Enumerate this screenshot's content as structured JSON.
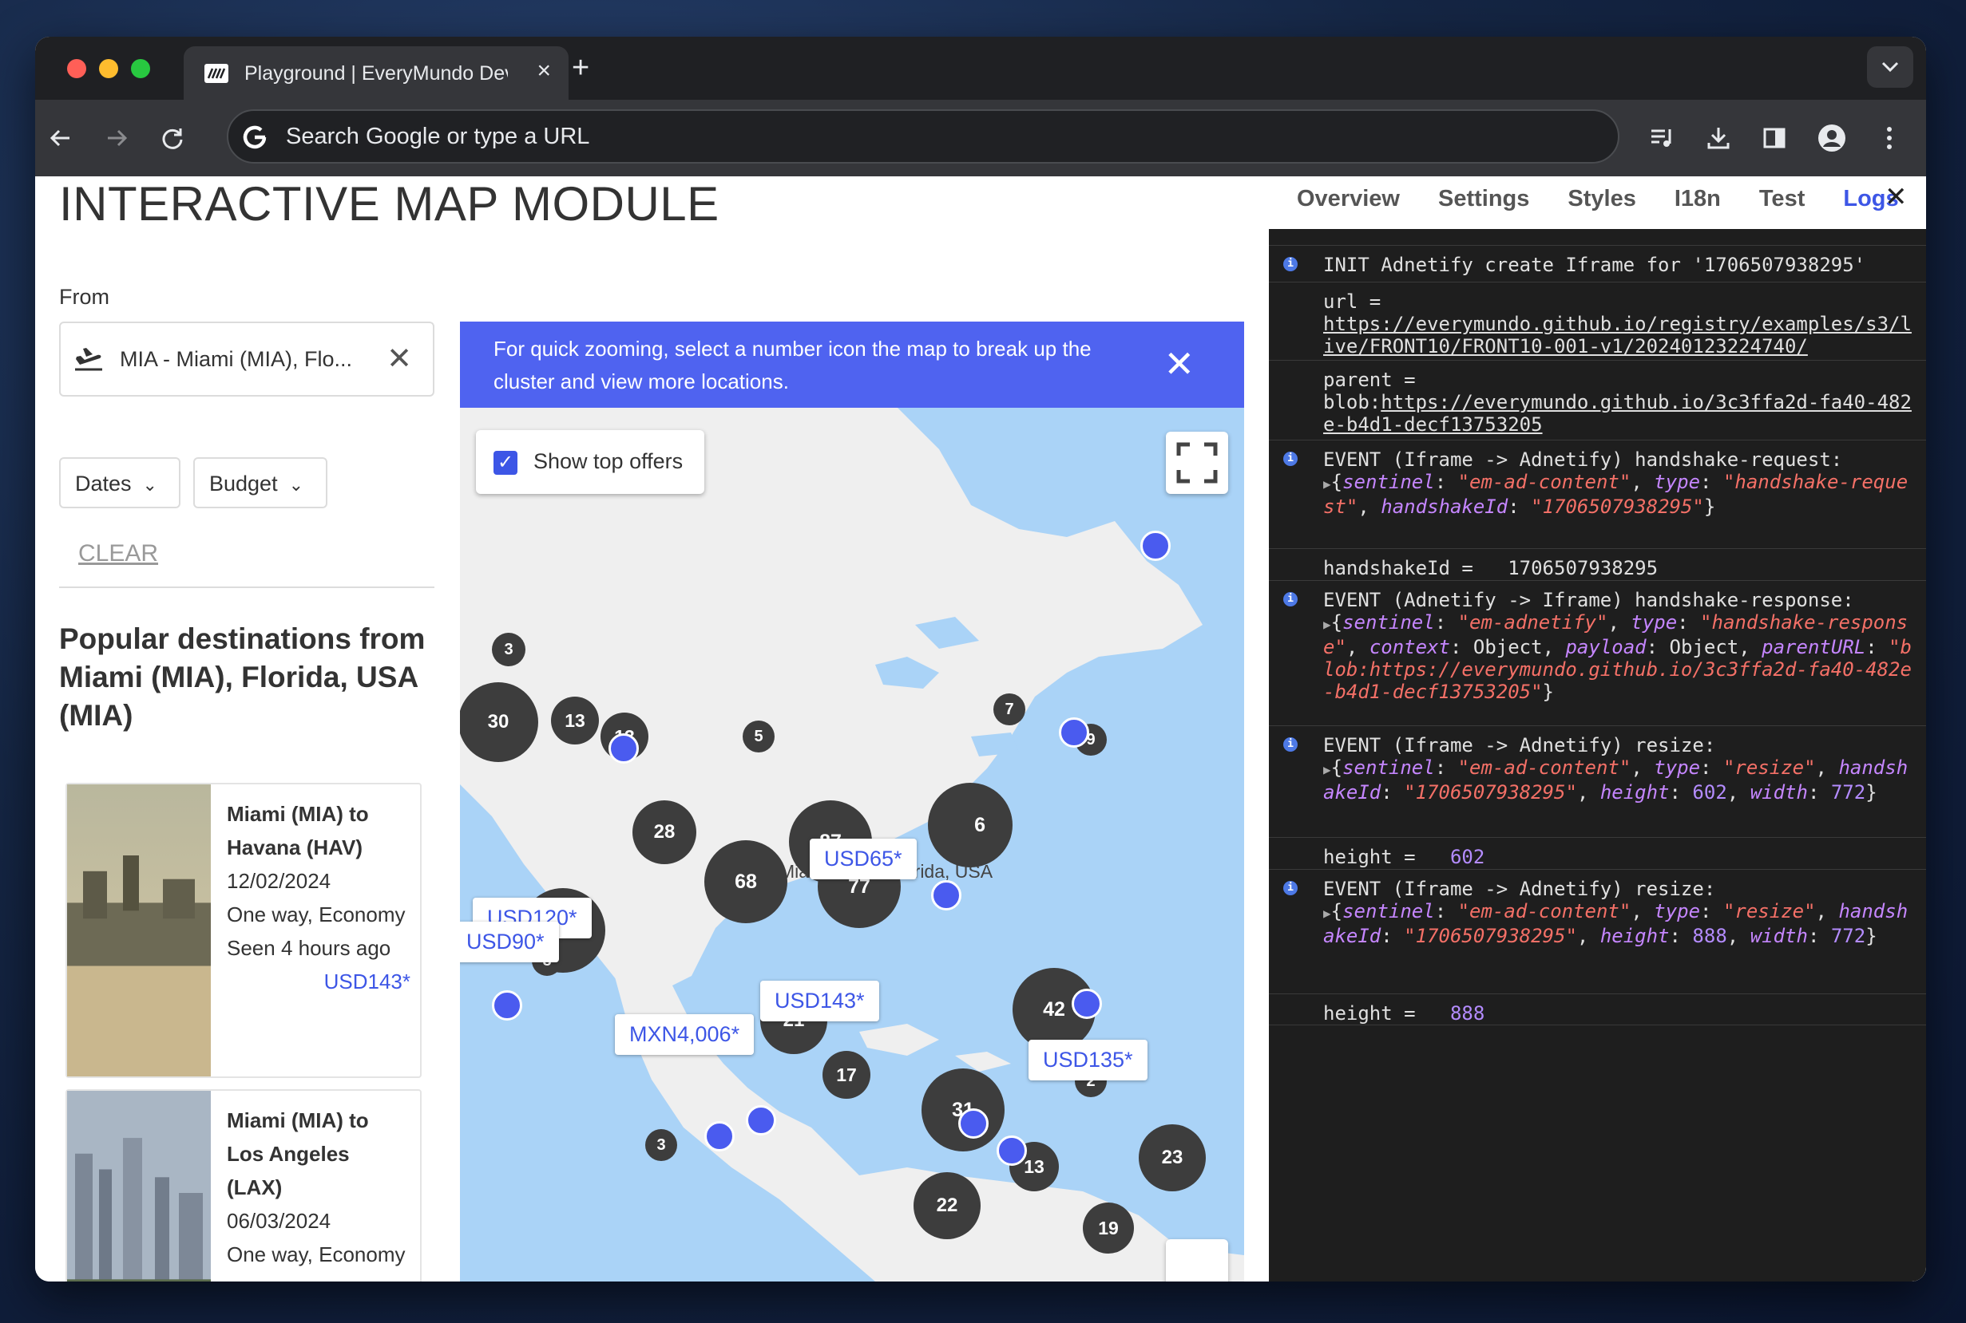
{
  "browser": {
    "tab_title": "Playground | EveryMundo Dev",
    "omnibox_placeholder": "Search Google or type a URL"
  },
  "page": {
    "title": "INTERACTIVE MAP MODULE",
    "tabs": [
      "Overview",
      "Settings",
      "Styles",
      "I18n",
      "Test",
      "Logs"
    ],
    "active_tab": "Logs"
  },
  "search": {
    "from_label": "From",
    "from_value": "MIA - Miami (MIA), Flo...",
    "dates_label": "Dates",
    "budget_label": "Budget",
    "clear_label": "CLEAR"
  },
  "popular": {
    "title": "Popular destinations from Miami (MIA), Florida, USA (MIA)",
    "cards": [
      {
        "route": "Miami (MIA) to Havana (HAV)",
        "date": "12/02/2024",
        "fare": "One way, Economy",
        "seen": "Seen 4 hours ago",
        "price": "USD143*"
      },
      {
        "route": "Miami (MIA) to Los Angeles (LAX)",
        "date": "06/03/2024",
        "fare": "One way, Economy",
        "seen": "",
        "price": ""
      }
    ]
  },
  "map": {
    "banner": "For quick zooming, select a number icon the map to break up the cluster and view more locations.",
    "show_top_offers": "Show top offers",
    "show_top_offers_checked": true,
    "city_label": "Miami (MIA), Florida, USA",
    "clusters": [
      "3",
      "30",
      "13",
      "13",
      "5",
      "7",
      "9",
      "28",
      "87",
      "6",
      "31",
      "68",
      "77",
      "8",
      "21",
      "17",
      "42",
      "2",
      "31",
      "3",
      "13",
      "23",
      "22",
      "19"
    ],
    "price_tags": [
      "USD65*",
      "USD120*",
      "USD90*",
      "USD143*",
      "MXN4,006*",
      "U",
      "USD135*",
      "XN"
    ]
  },
  "logs": [
    {
      "type": "info",
      "text": "INIT Adnetify create Iframe for '1706507938295'"
    },
    {
      "type": "plain",
      "label": "url =",
      "link": "https://everymundo.github.io/registry/examples/s3/live/FRONT10/FRONT10-001-v1/20240123224740/"
    },
    {
      "type": "plain",
      "label": "parent =",
      "prefix": "blob:",
      "link": "https://everymundo.github.io/3c3ffa2d-fa40-482e-b4d1-decf13753205"
    },
    {
      "type": "info",
      "text": "EVENT (Iframe -> Adnetify) handshake-request:"
    },
    {
      "type": "plain",
      "label": "handshakeId =",
      "value": "1706507938295"
    },
    {
      "type": "info",
      "text": "EVENT (Adnetify -> Iframe) handshake-response:"
    },
    {
      "type": "info",
      "text": "EVENT (Iframe -> Adnetify) resize:"
    },
    {
      "type": "plain",
      "label": "height =",
      "value": "602"
    },
    {
      "type": "info",
      "text": "EVENT (Iframe -> Adnetify) resize:"
    },
    {
      "type": "plain",
      "label": "height =",
      "value": "888"
    }
  ],
  "log_objects": {
    "hs_request": {
      "sentinel": "\"em-ad-content\"",
      "type": "\"handshake-request\"",
      "handshakeId": "\"1706507938295\""
    },
    "hs_response": {
      "sentinel": "\"em-adnetify\"",
      "type": "\"handshake-response\"",
      "context": "Object",
      "payload": "Object",
      "parentURL": "\"blob:https://everymundo.github.io/3c3ffa2d-fa40-482e-b4d1-decf13753205\""
    },
    "resize1": {
      "sentinel": "\"em-ad-content\"",
      "type": "\"resize\"",
      "handshakeId": "\"1706507938295\"",
      "height": "602",
      "width": "772"
    },
    "resize2": {
      "sentinel": "\"em-ad-content\"",
      "type": "\"resize\"",
      "handshakeId": "\"1706507938295\"",
      "height": "888",
      "width": "772"
    }
  },
  "colors": {
    "accent": "#3d56e6",
    "banner": "#4f63f0",
    "cluster": "#3d3d3d",
    "map_water": "#aad3f7",
    "map_land": "#efefef",
    "devtools_bg": "#1e1e1e"
  }
}
